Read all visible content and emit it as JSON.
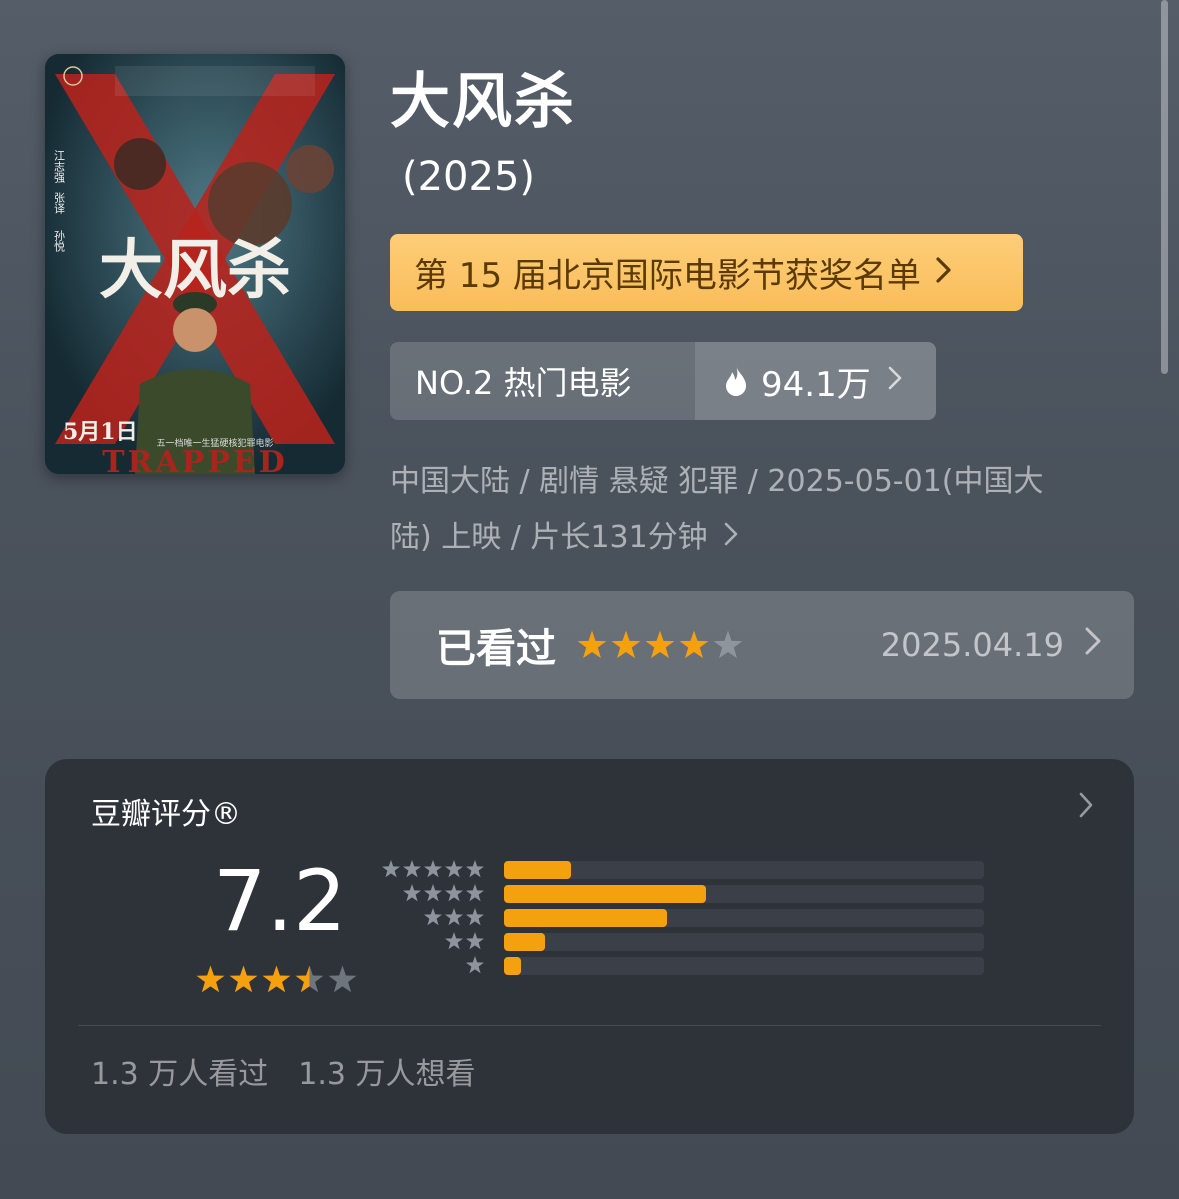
{
  "movie": {
    "title": "大风杀",
    "year": "(2025)",
    "award_banner": "第 15 届北京国际电影节获奖名单",
    "rank_label": "NO.2 热门电影",
    "heat": "94.1万",
    "meta_line1": "中国大陆 / 剧情 悬疑 犯罪 / 2025-05-01(中国大",
    "meta_line2": "陆) 上映 / 片长131分钟"
  },
  "poster": {
    "title_text": "大风杀",
    "release_text": "5月1日",
    "tagline": "五一档唯一生猛硬核犯罪电影",
    "english_title": "TRAPPED",
    "cast_left": [
      "江志强",
      "张译",
      "孙悦"
    ]
  },
  "watched": {
    "label": "已看过",
    "user_rating": 4,
    "user_rating_max": 5,
    "date": "2025.04.19"
  },
  "rating": {
    "title": "豆瓣评分®",
    "score": "7.2",
    "score_stars": 3.5,
    "distribution": [
      {
        "stars": 5,
        "fraction": 0.14
      },
      {
        "stars": 4,
        "fraction": 0.42
      },
      {
        "stars": 3,
        "fraction": 0.34
      },
      {
        "stars": 2,
        "fraction": 0.085
      },
      {
        "stars": 1,
        "fraction": 0.035
      }
    ],
    "watched_count": "1.3 万人看过",
    "want_count": "1.3 万人想看"
  },
  "colors": {
    "accent_orange": "#f5a00f",
    "banner_yellow": "#fecd78",
    "card_bg": "#2e333a"
  },
  "icons": {
    "chevron": "chevron-right-icon",
    "flame": "flame-icon",
    "star": "star-icon"
  }
}
